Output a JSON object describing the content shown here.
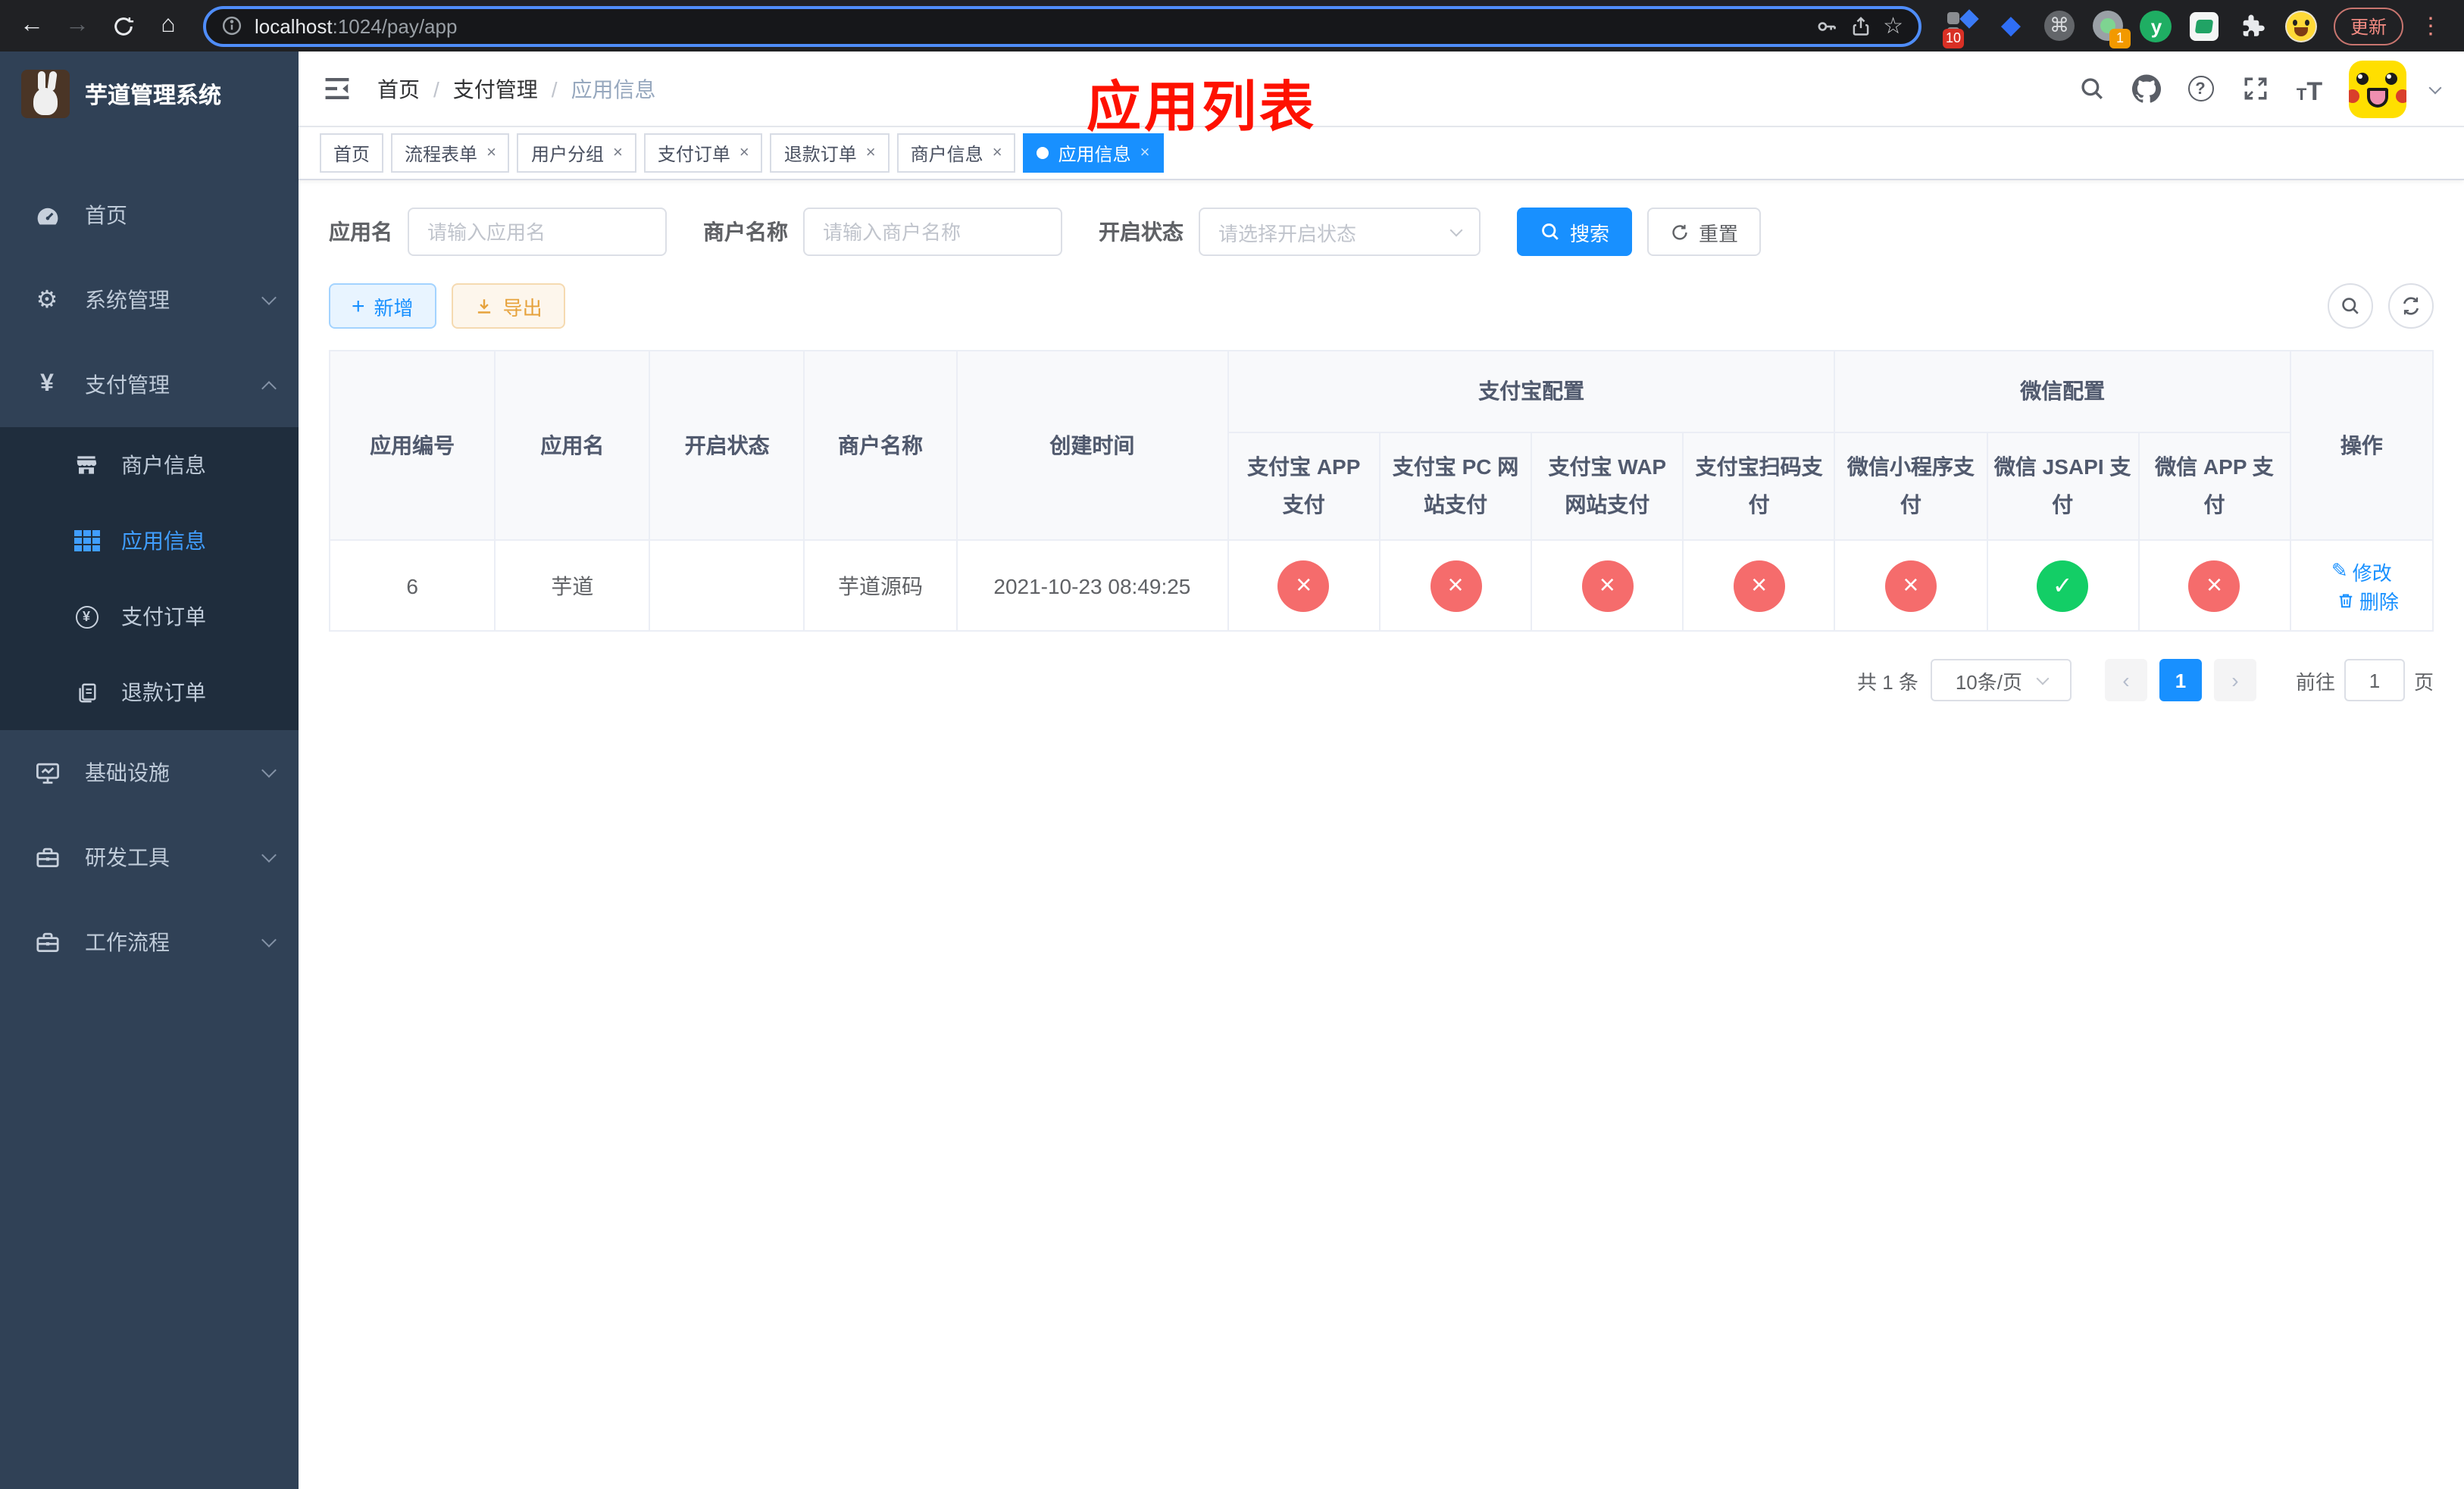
{
  "browser": {
    "url_host": "localhost",
    "url_rest": ":1024/pay/app",
    "update_label": "更新",
    "extension_badge_1": "10",
    "extension_badge_2": "1",
    "extension_y_label": "y"
  },
  "sidebar": {
    "title": "芋道管理系统",
    "menu": [
      {
        "label": "首页"
      },
      {
        "label": "系统管理"
      },
      {
        "label": "支付管理"
      },
      {
        "label": "基础设施"
      },
      {
        "label": "研发工具"
      },
      {
        "label": "工作流程"
      }
    ],
    "submenu": [
      {
        "label": "商户信息",
        "active": false
      },
      {
        "label": "应用信息",
        "active": true
      },
      {
        "label": "支付订单",
        "active": false
      },
      {
        "label": "退款订单",
        "active": false
      }
    ]
  },
  "breadcrumb": {
    "items": [
      "首页",
      "支付管理",
      "应用信息"
    ]
  },
  "annotation": "应用列表",
  "tabs": {
    "items": [
      {
        "label": "首页",
        "closable": false,
        "active": false
      },
      {
        "label": "流程表单",
        "closable": true,
        "active": false
      },
      {
        "label": "用户分组",
        "closable": true,
        "active": false
      },
      {
        "label": "支付订单",
        "closable": true,
        "active": false
      },
      {
        "label": "退款订单",
        "closable": true,
        "active": false
      },
      {
        "label": "商户信息",
        "closable": true,
        "active": false
      },
      {
        "label": "应用信息",
        "closable": true,
        "active": true
      }
    ],
    "close_glyph": "×"
  },
  "filters": {
    "app_name_label": "应用名",
    "app_name_placeholder": "请输入应用名",
    "merchant_label": "商户名称",
    "merchant_placeholder": "请输入商户名称",
    "status_label": "开启状态",
    "status_placeholder": "请选择开启状态",
    "search_label": "搜索",
    "reset_label": "重置"
  },
  "toolbar": {
    "add_label": "新增",
    "export_label": "导出"
  },
  "table": {
    "groups": {
      "alipay": "支付宝配置",
      "wechat": "微信配置"
    },
    "main_cols": [
      "应用编号",
      "应用名",
      "开启状态",
      "商户名称",
      "创建时间"
    ],
    "alipay_cols": [
      "支付宝 APP 支付",
      "支付宝 PC 网站支付",
      "支付宝 WAP 网站支付",
      "支付宝扫码支付"
    ],
    "wechat_cols": [
      "微信小程序支付",
      "微信 JSAPI 支付",
      "微信 APP 支付"
    ],
    "actions_col": "操作",
    "row": {
      "id": "6",
      "name": "芋道",
      "switch_state": "on",
      "merchant": "芋道源码",
      "created": "2021-10-23 08:49:25",
      "statuses": [
        "disabled",
        "disabled",
        "disabled",
        "disabled",
        "disabled",
        "enabled",
        "disabled"
      ],
      "edit_label": "修改",
      "delete_label": "删除"
    }
  },
  "pagination": {
    "total": "共 1 条",
    "page_size": "10条/页",
    "prev_glyph": "‹",
    "page": "1",
    "next_glyph": "›",
    "goto_label": "前往",
    "goto_value": "1",
    "page_unit": "页"
  },
  "icons": {
    "back": "←",
    "forward": "→",
    "home": "⌂",
    "star": "☆",
    "command": "⌘",
    "kebab": "⋮",
    "kite": "◆",
    "status-cross": "×",
    "status-check": "✓",
    "yen": "¥",
    "edit-pen": "✎",
    "gear": "⚙"
  },
  "colors": {
    "primary": "#1890ff",
    "menu_active": "#409eff",
    "danger": "#f56c6c",
    "success": "#13ce66",
    "sidebar_bg": "#304156",
    "submenu_bg": "#1f2d3d",
    "annotation": "#fe1100",
    "warning": "#e6a23c",
    "browser_bg": "#202124"
  }
}
